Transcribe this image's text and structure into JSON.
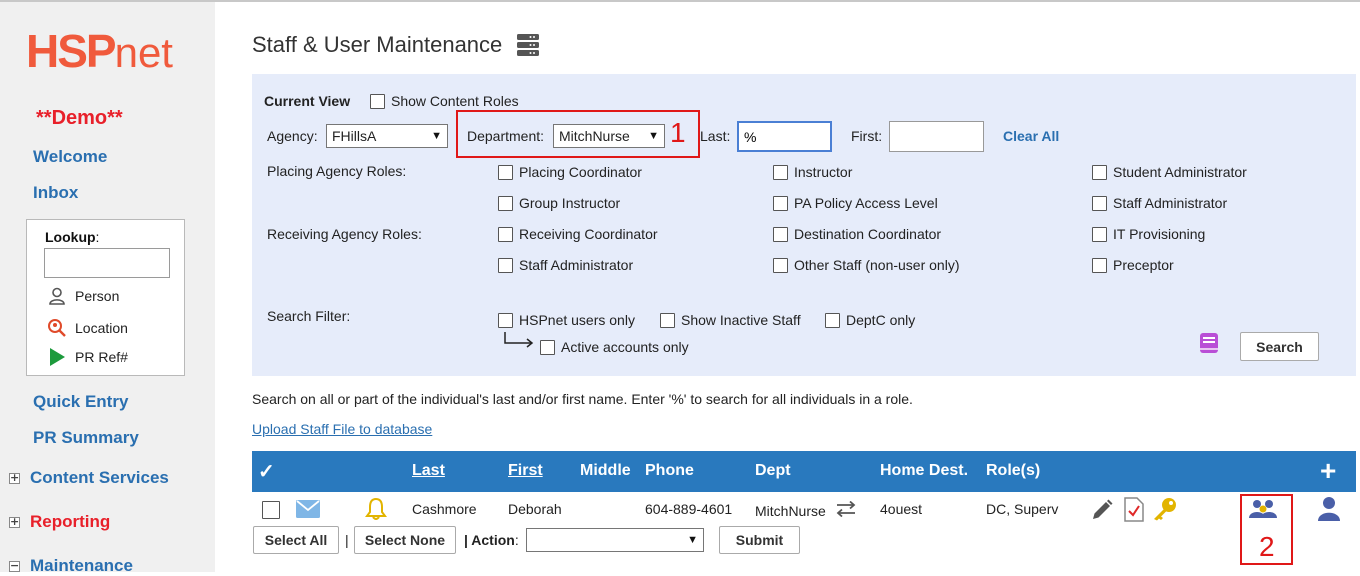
{
  "app": {
    "logo_big": "HSP",
    "logo_small": "net",
    "demo_label": "**Demo**"
  },
  "sidebar": {
    "welcome": "Welcome",
    "inbox": "Inbox",
    "lookup": {
      "label": "Lookup",
      "colon": ":",
      "input_value": "",
      "items": [
        {
          "label": "Person",
          "icon": "person-icon"
        },
        {
          "label": "Location",
          "icon": "location-search-icon"
        },
        {
          "label": "PR Ref#",
          "icon": "play-icon"
        }
      ]
    },
    "quick_entry": "Quick Entry",
    "pr_summary": "PR Summary",
    "sections": [
      {
        "label": "Content Services",
        "toggle": "+",
        "color": "#2a6fb0"
      },
      {
        "label": "Reporting",
        "toggle": "+",
        "color": "#e8202a"
      },
      {
        "label": "Maintenance",
        "toggle": "−",
        "color": "#2a6fb0"
      }
    ]
  },
  "page": {
    "title": "Staff & User Maintenance"
  },
  "filters": {
    "current_view": "Current View",
    "show_content_roles": "Show Content Roles",
    "agency_label": "Agency:",
    "agency_value": "FHillsA",
    "department_label": "Department:",
    "department_value": "MitchNurse",
    "last_label": "Last:",
    "last_value": "%",
    "first_label": "First:",
    "first_value": "",
    "clear_all": "Clear All",
    "placing_roles_label": "Placing Agency Roles:",
    "receiving_roles_label": "Receiving Agency Roles:",
    "roles_col1": [
      "Placing Coordinator",
      "Group Instructor",
      "Receiving Coordinator",
      "Staff Administrator"
    ],
    "roles_col2": [
      "Instructor",
      "PA Policy Access Level",
      "Destination Coordinator",
      "Other Staff (non-user only)"
    ],
    "roles_col3": [
      "Student Administrator",
      "Staff Administrator",
      "IT Provisioning",
      "Preceptor"
    ],
    "search_filter_label": "Search Filter:",
    "hspnet_users_only": "HSPnet users only",
    "show_inactive": "Show Inactive Staff",
    "deptc_only": "DeptC only",
    "active_accounts_only": "Active accounts only",
    "search_button": "Search"
  },
  "annotations": {
    "marker1": "1",
    "marker2": "2"
  },
  "hint": "Search on all or part of the individual's last and/or first name. Enter '%' to search for all individuals in a role.",
  "upload_link": "Upload Staff File to database",
  "table": {
    "headers": {
      "check": "✓",
      "last": "Last",
      "first": "First",
      "middle": "Middle",
      "phone": "Phone",
      "dept": "Dept",
      "home_dest": "Home Dest.",
      "roles": "Role(s)",
      "add": "+"
    },
    "rows": [
      {
        "last": "Cashmore",
        "first": "Deborah",
        "middle": "",
        "phone": "604-889-4601",
        "dept": "MitchNurse",
        "home_dest": "4ouest",
        "roles": "DC, Superv"
      }
    ]
  },
  "footer": {
    "select_all": "Select All",
    "sep1": "|",
    "select_none": "Select None",
    "action_label": "| Action",
    "action_colon": ":",
    "action_value": "",
    "submit": "Submit"
  },
  "colors": {
    "brand": "#f05a3c",
    "link": "#2a6fb0",
    "header_bg": "#2979be",
    "panel_bg": "#e6ecfa",
    "annotation": "#e01818"
  }
}
